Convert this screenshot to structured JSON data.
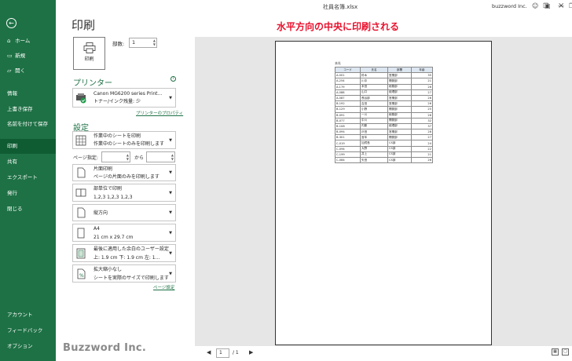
{
  "window": {
    "title": "社員名簿.xlsx",
    "user": "buzzword Inc."
  },
  "sidebar": {
    "back": "←",
    "items": [
      {
        "label": "ホーム",
        "icon": "⌂"
      },
      {
        "label": "新規",
        "icon": "▭"
      },
      {
        "label": "開く",
        "icon": "▱"
      },
      {
        "label": "情報"
      },
      {
        "label": "上書き保存"
      },
      {
        "label": "名前を付けて保存"
      },
      {
        "label": "印刷"
      },
      {
        "label": "共有"
      },
      {
        "label": "エクスポート"
      },
      {
        "label": "発行"
      },
      {
        "label": "閉じる"
      },
      {
        "label": "アカウント"
      },
      {
        "label": "フィードバック"
      },
      {
        "label": "オプション"
      }
    ]
  },
  "print": {
    "heading": "印刷",
    "button_label": "印刷",
    "copies_label": "部数:",
    "copies_value": "1",
    "printer_heading": "プリンター",
    "printer_name": "Canon MG6200 series Print…",
    "printer_status": "トナー/インク残量: 少",
    "printer_props_link": "プリンターのプロパティ",
    "settings_heading": "設定",
    "settings": [
      {
        "line1": "作業中のシートを印刷",
        "line2": "作業中のシートのみを印刷します"
      },
      {
        "line1": "片面印刷",
        "line2": "ページの片面のみを印刷します"
      },
      {
        "line1": "部単位で印刷",
        "line2": "1,2,3    1,2,3    1,2,3"
      },
      {
        "line1": "縦方向",
        "line2": ""
      },
      {
        "line1": "A4",
        "line2": "21 cm x 29.7 cm"
      },
      {
        "line1": "最後に適用した余白のユーザー設定",
        "line2": "上: 1.9 cm 下: 1.9 cm 左: 1…"
      },
      {
        "line1": "拡大縮小なし",
        "line2": "シートを実際のサイズで印刷します"
      }
    ],
    "pages_label": "ページ指定:",
    "pages_to": "から",
    "page_setup_link": "ページ設定"
  },
  "brand": "Buzzword Inc.",
  "annotation": "水平方向の中央に印刷される",
  "preview": {
    "caption": "本社",
    "headers": [
      "コード",
      "氏名",
      "部署",
      "年齢"
    ],
    "rows": [
      [
        "A-001",
        "鈴木",
        "営業部",
        "35"
      ],
      [
        "A-254",
        "川中",
        "開発部",
        "21"
      ],
      [
        "A-179",
        "本田",
        "総務部",
        "26"
      ],
      [
        "A-088",
        "山口",
        "経理部",
        "27"
      ],
      [
        "A-087",
        "長谷部",
        "営業部",
        "26"
      ],
      [
        "B-192",
        "吉田",
        "営業部",
        "26"
      ],
      [
        "B-129",
        "小野",
        "開発部",
        "25"
      ],
      [
        "B-091",
        "一川",
        "総務部",
        "26"
      ],
      [
        "B-077",
        "中川",
        "開発部",
        "32"
      ],
      [
        "B-108",
        "内藤",
        "経理部",
        "37"
      ],
      [
        "B-094",
        "戸田",
        "営業部",
        "28"
      ],
      [
        "B-301",
        "宮本",
        "開発部",
        "27"
      ],
      [
        "C-019",
        "加賀島",
        "CS部",
        "24"
      ],
      [
        "C-094",
        "大野",
        "CS部",
        "22"
      ],
      [
        "C-199",
        "井上",
        "CS部",
        "21"
      ],
      [
        "C-084",
        "矢田",
        "CS部",
        "26"
      ]
    ],
    "page_current": "1",
    "page_total": "/ 1"
  }
}
